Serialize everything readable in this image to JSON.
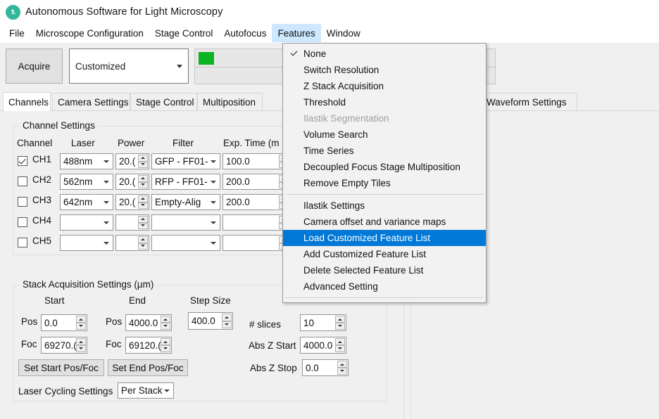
{
  "window": {
    "title": "Autonomous Software for Light Microscopy",
    "logo_icon": "microscope-icon"
  },
  "menubar": {
    "items": [
      {
        "label": "File",
        "active": false
      },
      {
        "label": "Microscope Configuration",
        "active": false
      },
      {
        "label": "Stage Control",
        "active": false
      },
      {
        "label": "Autofocus",
        "active": false
      },
      {
        "label": "Features",
        "active": true
      },
      {
        "label": "Window",
        "active": false
      }
    ]
  },
  "toolbar": {
    "acquire_label": "Acquire",
    "mode_value": "Customized",
    "status_color": "#0cb323"
  },
  "tabs": {
    "items": [
      {
        "label": "Channels",
        "selected": true
      },
      {
        "label": "Camera Settings",
        "selected": false
      },
      {
        "label": "Stage Control",
        "selected": false
      },
      {
        "label": "Multiposition",
        "selected": false
      },
      {
        "label": "Waveform Settings",
        "selected": false
      }
    ]
  },
  "channel_settings": {
    "group_title": "Channel Settings",
    "headers": {
      "channel": "Channel",
      "laser": "Laser",
      "power": "Power",
      "filter": "Filter",
      "exposure": "Exp. Time (m"
    },
    "rows": [
      {
        "name": "CH1",
        "checked": true,
        "laser": "488nm",
        "power": "20.(",
        "filter": "GFP - FF01-",
        "exposure": "100.0"
      },
      {
        "name": "CH2",
        "checked": false,
        "laser": "562nm",
        "power": "20.(",
        "filter": "RFP - FF01-",
        "exposure": "200.0"
      },
      {
        "name": "CH3",
        "checked": false,
        "laser": "642nm",
        "power": "20.(",
        "filter": "Empty-Alig",
        "exposure": "200.0"
      },
      {
        "name": "CH4",
        "checked": false,
        "laser": "",
        "power": "",
        "filter": "",
        "exposure": ""
      },
      {
        "name": "CH5",
        "checked": false,
        "laser": "",
        "power": "",
        "filter": "",
        "exposure": ""
      }
    ]
  },
  "stack_settings": {
    "group_title": "Stack Acquisition Settings (µm)",
    "col_start": "Start",
    "col_end": "End",
    "col_step": "Step Size",
    "label_pos": "Pos",
    "label_foc": "Foc",
    "start_pos": "0.0",
    "start_foc": "69270.(",
    "end_pos": "4000.0",
    "end_foc": "69120.(",
    "step_size": "400.0",
    "label_slices": "# slices",
    "slices": "10",
    "label_abs_z_start": "Abs Z Start",
    "abs_z_start": "4000.0",
    "label_abs_z_stop": "Abs Z Stop",
    "abs_z_stop": "0.0",
    "btn_set_start": "Set Start Pos/Foc",
    "btn_set_end": "Set End Pos/Foc",
    "label_laser_cycling": "Laser Cycling Settings",
    "laser_cycling_value": "Per Stack"
  },
  "features_menu": {
    "highlight_color": "#0078d7",
    "items": [
      {
        "label": "None",
        "checked": true,
        "disabled": false,
        "highlight": false
      },
      {
        "label": "Switch Resolution",
        "checked": false,
        "disabled": false,
        "highlight": false
      },
      {
        "label": "Z Stack Acquisition",
        "checked": false,
        "disabled": false,
        "highlight": false
      },
      {
        "label": "Threshold",
        "checked": false,
        "disabled": false,
        "highlight": false
      },
      {
        "label": "Ilastik Segmentation",
        "checked": false,
        "disabled": true,
        "highlight": false
      },
      {
        "label": "Volume Search",
        "checked": false,
        "disabled": false,
        "highlight": false
      },
      {
        "label": "Time Series",
        "checked": false,
        "disabled": false,
        "highlight": false
      },
      {
        "label": "Decoupled Focus Stage Multiposition",
        "checked": false,
        "disabled": false,
        "highlight": false
      },
      {
        "label": "Remove Empty Tiles",
        "checked": false,
        "disabled": false,
        "highlight": false
      },
      {
        "separator": true
      },
      {
        "label": "Ilastik Settings",
        "checked": false,
        "disabled": false,
        "highlight": false
      },
      {
        "label": "Camera offset and variance maps",
        "checked": false,
        "disabled": false,
        "highlight": false
      },
      {
        "label": "Load Customized Feature List",
        "checked": false,
        "disabled": false,
        "highlight": true
      },
      {
        "label": "Add Customized Feature List",
        "checked": false,
        "disabled": false,
        "highlight": false
      },
      {
        "label": "Delete Selected Feature List",
        "checked": false,
        "disabled": false,
        "highlight": false
      },
      {
        "label": "Advanced Setting",
        "checked": false,
        "disabled": false,
        "highlight": false
      },
      {
        "separator": true
      }
    ]
  }
}
